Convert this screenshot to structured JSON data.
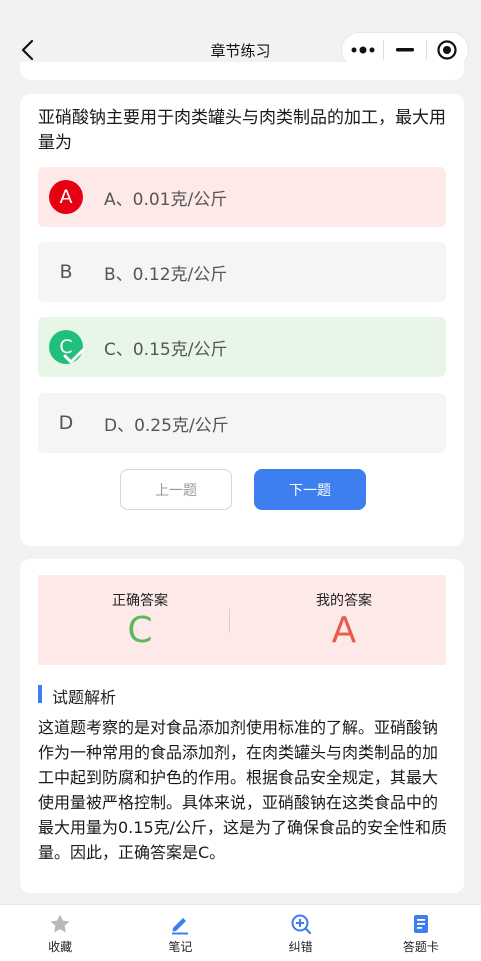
{
  "header": {
    "title": "章节练习"
  },
  "question": {
    "text": " 亚硝酸钠主要用于肉类罐头与肉类制品的加工，最大用量为",
    "options": [
      {
        "letter": "A",
        "label": "A、0.01克/公斤",
        "state": "wrong"
      },
      {
        "letter": "B",
        "label": "B、0.12克/公斤",
        "state": "normal"
      },
      {
        "letter": "C",
        "label": "C、0.15克/公斤",
        "state": "correct"
      },
      {
        "letter": "D",
        "label": "D、0.25克/公斤",
        "state": "normal"
      }
    ],
    "prev_label": "上一题",
    "next_label": "下一题"
  },
  "answer": {
    "correct_label": "正确答案",
    "correct_value": "C",
    "mine_label": "我的答案",
    "mine_value": "A",
    "section_title": "试题解析",
    "explanation": " 这道题考察的是对食品添加剂使用标准的了解。亚硝酸钠作为一种常用的食品添加剂，在肉类罐头与肉类制品的加工中起到防腐和护色的作用。根据食品安全规定，其最大使用量被严格控制。具体来说，亚硝酸钠在这类食品中的最大用量为0.15克/公斤，这是为了确保食品的安全性和质量。因此，正确答案是C。"
  },
  "tabbar": {
    "items": [
      {
        "label": "收藏",
        "icon": "star-icon"
      },
      {
        "label": "笔记",
        "icon": "pencil-icon"
      },
      {
        "label": "纠错",
        "icon": "correction-icon"
      },
      {
        "label": "答题卡",
        "icon": "answer-sheet-icon"
      }
    ]
  },
  "colors": {
    "primary": "#3d7ef0",
    "wrong": "#e60012",
    "correct": "#21c07a",
    "wrong_bg": "#fde9e7",
    "correct_bg": "#e8f6e8"
  }
}
